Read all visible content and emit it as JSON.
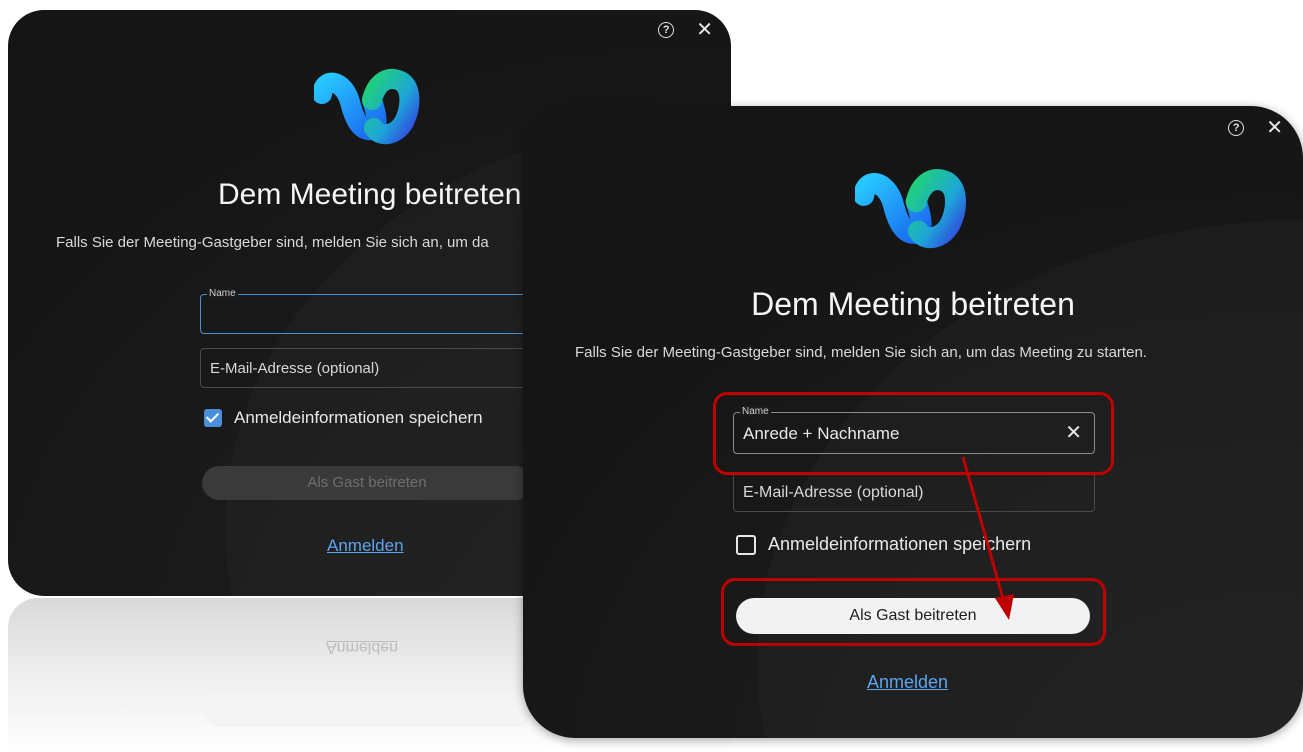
{
  "back_window": {
    "title": "Dem Meeting beitreten",
    "subtitle": "Falls Sie der Meeting-Gastgeber sind, melden Sie sich an, um da",
    "name_field": {
      "label": "Name",
      "value": ""
    },
    "email_field": {
      "placeholder": "E-Mail-Adresse (optional)"
    },
    "remember_checkbox": {
      "label": "Anmeldeinformationen speichern",
      "checked": true
    },
    "join_button": "Als Gast beitreten",
    "signin_link": "Anmelden",
    "reflection_link": "Anmelden"
  },
  "front_window": {
    "title": "Dem Meeting beitreten",
    "subtitle": "Falls Sie der Meeting-Gastgeber sind, melden Sie sich an, um das Meeting zu starten.",
    "name_field": {
      "label": "Name",
      "value": "Anrede + Nachname"
    },
    "email_field": {
      "placeholder": "E-Mail-Adresse (optional)"
    },
    "remember_checkbox": {
      "label": "Anmeldeinformationen speichern",
      "checked": false
    },
    "join_button": "Als Gast beitreten",
    "signin_link": "Anmelden"
  },
  "icons": {
    "help": "help-icon",
    "close": "close-icon",
    "clear": "clear-icon",
    "logo": "webex-logo"
  },
  "colors": {
    "window_bg": "#1b1b1b",
    "link": "#5aa4f0",
    "highlight": "#c00000",
    "checkbox_checked": "#4a90d9"
  }
}
